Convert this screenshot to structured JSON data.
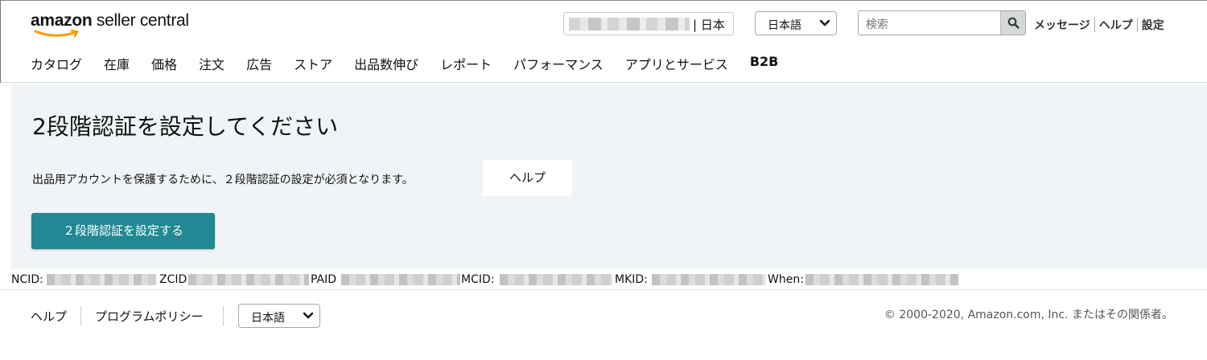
{
  "header": {
    "logo_bold": "amazon",
    "logo_rest": " seller central",
    "marketplace_text": "| 日本",
    "language_selected": "日本語",
    "search_placeholder": "検索",
    "links": [
      "メッセージ",
      "ヘルプ",
      "設定"
    ]
  },
  "nav": {
    "items": [
      "カタログ",
      "在庫",
      "価格",
      "注文",
      "広告",
      "ストア",
      "出品数伸び",
      "レポート",
      "パフォーマンス",
      "アプリとサービス",
      "B2B"
    ]
  },
  "main": {
    "title": "2段階認証を設定してください",
    "description": "出品用アカウントを保護するために、２段階認証の設定が必須となります。",
    "help_button": "ヘルプ",
    "primary_button": "２段階認証を設定する"
  },
  "ids": {
    "ncid_label": "NCID:",
    "zcid_label": "ZCID",
    "paid_label": "PAID",
    "mcid_label": "MCID:",
    "mkid_label": "MKID:",
    "when_label": "When:"
  },
  "footer": {
    "help": "ヘルプ",
    "program_policy": "プログラムポリシー",
    "language_selected": "日本語",
    "copyright": "© 2000-2020, Amazon.com, Inc. またはその関係者。"
  },
  "colors": {
    "primary_button": "#218894",
    "main_background": "#f1f4f6",
    "logo_smile": "#ff9900"
  },
  "icons": [
    "amazon-smile-icon",
    "chevron-down-icon",
    "search-icon"
  ]
}
